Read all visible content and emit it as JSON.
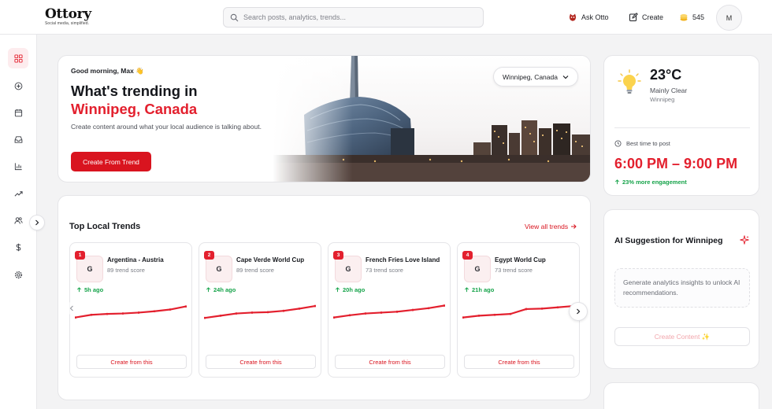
{
  "brand": {
    "name": "Ottory",
    "tagline": "Social media, simplified."
  },
  "search": {
    "placeholder": "Search posts, analytics, trends..."
  },
  "topbar": {
    "ask_label": "Ask Otto",
    "create_label": "Create",
    "credits": "545",
    "avatar_initial": "M"
  },
  "sidebar": {
    "items": [
      {
        "icon": "dashboard-icon",
        "active": true
      },
      {
        "icon": "plus-circle-icon"
      },
      {
        "icon": "calendar-icon"
      },
      {
        "icon": "inbox-icon"
      },
      {
        "icon": "analytics-icon"
      },
      {
        "icon": "trending-icon"
      },
      {
        "icon": "users-icon"
      },
      {
        "icon": "dollar-icon"
      },
      {
        "icon": "settings-icon"
      }
    ]
  },
  "hero": {
    "greeting": "Good morning, Max 👋",
    "title": "What's trending in",
    "city": "Winnipeg, Canada",
    "description": "Create content around what your local audience is talking about.",
    "cta": "Create From Trend",
    "location_select": "Winnipeg, Canada"
  },
  "trends": {
    "title": "Top Local Trends",
    "view_all": "View all trends",
    "items": [
      {
        "rank": "1",
        "letter": "G",
        "name": "Argentina - Austria",
        "score": "89 trend score",
        "time": "5h ago",
        "button": "Create from this",
        "spark": [
          30,
          42,
          46,
          48,
          52,
          58,
          66,
          80
        ]
      },
      {
        "rank": "2",
        "letter": "G",
        "name": "Cape Verde World Cup",
        "score": "89 trend score",
        "time": "24h ago",
        "button": "Create from this",
        "spark": [
          28,
          38,
          48,
          52,
          54,
          60,
          70,
          82
        ]
      },
      {
        "rank": "3",
        "letter": "G",
        "name": "French Fries Love Island",
        "score": "73 trend score",
        "time": "20h ago",
        "button": "Create from this",
        "spark": [
          30,
          40,
          48,
          52,
          56,
          64,
          72,
          84
        ]
      },
      {
        "rank": "4",
        "letter": "G",
        "name": "Egypt World Cup",
        "score": "73 trend score",
        "time": "21h ago",
        "button": "Create from this",
        "spark": [
          30,
          38,
          42,
          46,
          68,
          70,
          76,
          82
        ]
      }
    ]
  },
  "weather": {
    "temp": "23°C",
    "condition": "Mainly Clear",
    "city": "Winnipeg",
    "best_time_label": "Best time to post",
    "best_time": "6:00 PM – 9:00 PM",
    "engagement": "23% more engagement"
  },
  "ai": {
    "title": "AI Suggestion for Winnipeg",
    "message": "Generate analytics insights to unlock AI recommendations.",
    "button": "Create Content ✨"
  },
  "colors": {
    "accent": "#e3202e",
    "positive": "#16a34a"
  }
}
